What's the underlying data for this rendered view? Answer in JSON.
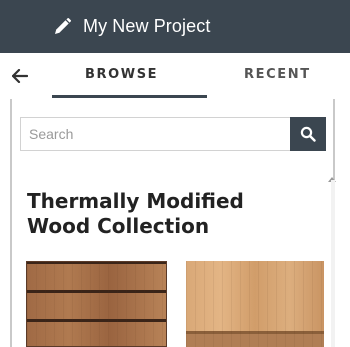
{
  "header": {
    "project_title": "My New Project"
  },
  "tabs": [
    {
      "label": "BROWSE",
      "active": true
    },
    {
      "label": "RECENT",
      "active": false
    }
  ],
  "search": {
    "placeholder": "Search",
    "value": ""
  },
  "collection": {
    "title_line1": "Thermally Modified",
    "title_line2": "Wood Collection"
  },
  "colors": {
    "header_bg": "#3b4650",
    "accent": "#3b4650",
    "text_dark": "#222222"
  },
  "icons": {
    "edit": "pencil-icon",
    "back": "back-arrow-icon",
    "search": "search-icon"
  }
}
